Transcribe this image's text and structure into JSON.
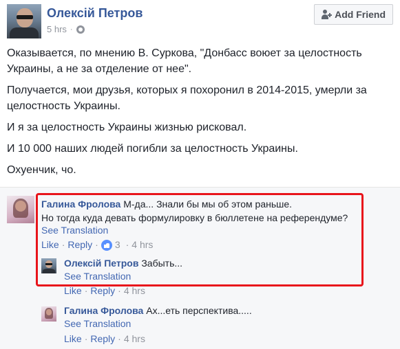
{
  "post": {
    "author": "Олексій Петров",
    "time": "5 hrs",
    "dot": "·",
    "add_friend_label": "Add Friend",
    "paragraphs": [
      "Оказывается, по мнению В. Суркова, \"Донбасс воюет за целостность Украины, а не за отделение от нее\".",
      "Получается, мои друзья, которых я похоронил в 2014-2015, умерли за целостность Украины.",
      "И я за целостность Украины жизнью рисковал.",
      "И 10 000 наших людей погибли за целостность Украины.",
      "Охуенчик, чо."
    ]
  },
  "comments": [
    {
      "author": "Галина Фролова",
      "lines": [
        "М-да... Знали бы мы об этом раньше.",
        "Но тогда куда девать формулировку в бюллетене на референдуме?"
      ],
      "see_translation": "See Translation",
      "like": "Like",
      "reply": "Reply",
      "reactions": "3",
      "time": "4 hrs",
      "sep": "·"
    },
    {
      "author": "Олексій Петров",
      "text": "Забыть...",
      "see_translation": "See Translation",
      "like": "Like",
      "reply": "Reply",
      "time": "4 hrs",
      "sep": "·"
    },
    {
      "author": "Галина Фролова",
      "text": "Ах...еть перспектива.....",
      "see_translation": "See Translation",
      "like": "Like",
      "reply": "Reply",
      "time": "4 hrs",
      "sep": "·"
    }
  ],
  "colors": {
    "name_link": "#365899",
    "action_link": "#4267b2",
    "highlight": "#e8141b",
    "muted": "#90949c"
  },
  "icons": [
    "globe-icon",
    "add-friend-icon",
    "like-reaction-icon"
  ]
}
